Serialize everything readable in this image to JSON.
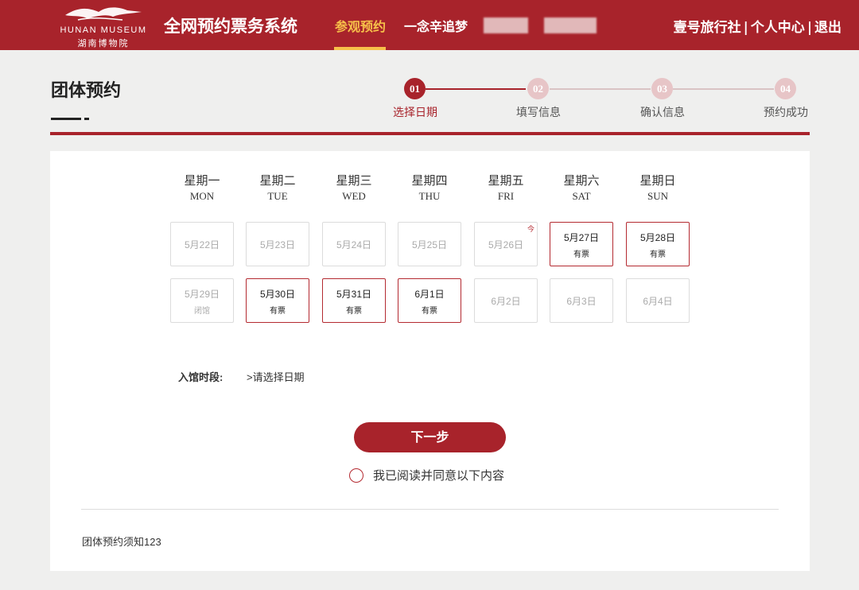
{
  "header": {
    "logo_en": "HUNAN MUSEUM",
    "logo_cn": "湖南博物院",
    "system_title": "全网预约票务系统",
    "nav": [
      {
        "label": "参观预约",
        "active": true
      },
      {
        "label": "一念辛追梦",
        "active": false
      }
    ],
    "user_links": [
      "壹号旅行社",
      "个人中心",
      "退出"
    ],
    "separator": "|",
    "colors": {
      "brand": "#a8232b",
      "nav_active": "#f7c04a"
    }
  },
  "page": {
    "title": "团体预约"
  },
  "steps": [
    {
      "num": "01",
      "label": "选择日期",
      "active": true
    },
    {
      "num": "02",
      "label": "填写信息",
      "active": false
    },
    {
      "num": "03",
      "label": "确认信息",
      "active": false
    },
    {
      "num": "04",
      "label": "预约成功",
      "active": false
    }
  ],
  "calendar": {
    "weekdays": [
      {
        "cn": "星期一",
        "en": "MON"
      },
      {
        "cn": "星期二",
        "en": "TUE"
      },
      {
        "cn": "星期三",
        "en": "WED"
      },
      {
        "cn": "星期四",
        "en": "THU"
      },
      {
        "cn": "星期五",
        "en": "FRI"
      },
      {
        "cn": "星期六",
        "en": "SAT"
      },
      {
        "cn": "星期日",
        "en": "SUN"
      }
    ],
    "weeks": [
      [
        {
          "date": "5月22日",
          "status": "",
          "available": false
        },
        {
          "date": "5月23日",
          "status": "",
          "available": false
        },
        {
          "date": "5月24日",
          "status": "",
          "available": false
        },
        {
          "date": "5月25日",
          "status": "",
          "available": false
        },
        {
          "date": "5月26日",
          "status": "",
          "available": false,
          "today_mark": "今"
        },
        {
          "date": "5月27日",
          "status": "有票",
          "available": true
        },
        {
          "date": "5月28日",
          "status": "有票",
          "available": true
        }
      ],
      [
        {
          "date": "5月29日",
          "status": "闭馆",
          "available": false
        },
        {
          "date": "5月30日",
          "status": "有票",
          "available": true
        },
        {
          "date": "5月31日",
          "status": "有票",
          "available": true
        },
        {
          "date": "6月1日",
          "status": "有票",
          "available": true
        },
        {
          "date": "6月2日",
          "status": "",
          "available": false
        },
        {
          "date": "6月3日",
          "status": "",
          "available": false
        },
        {
          "date": "6月4日",
          "status": "",
          "available": false
        }
      ]
    ]
  },
  "time_slot": {
    "label": "入馆时段:",
    "value": ">请选择日期"
  },
  "next_button": "下一步",
  "agreement": "我已阅读并同意以下内容",
  "notice": "团体预约须知123"
}
